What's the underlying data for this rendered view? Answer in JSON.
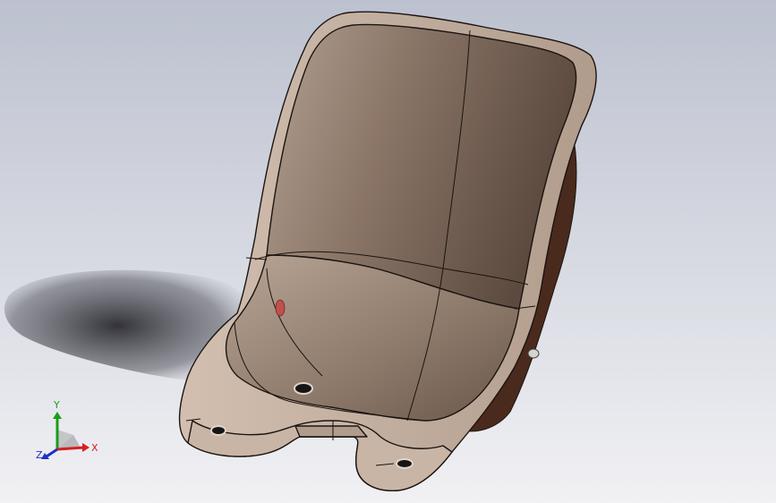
{
  "viewport": {
    "background_top": "#bcc1cf",
    "background_bottom": "#f1f1f4"
  },
  "model": {
    "shell_color": "#a39183",
    "shell_shadow_color": "#5e4b40",
    "rim_color": "#c6b2a3",
    "underside_color": "#4a2a1c",
    "edge_color": "#1a1410",
    "marker_color": "#c0504d",
    "hole_color": "#151515"
  },
  "triad": {
    "x_label": "X",
    "y_label": "Y",
    "z_label": "Z",
    "x_color": "#d42020",
    "y_color": "#1a9c1a",
    "z_color": "#2030c8"
  }
}
